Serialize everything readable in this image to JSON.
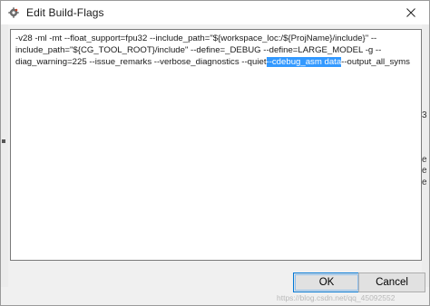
{
  "window": {
    "title": "Edit Build-Flags",
    "app_icon": "gear-icon",
    "close_icon": "close-icon"
  },
  "editor": {
    "line1": "-v28 -ml -mt --float_support=fpu32 --include_path=\"${workspace_loc:/${ProjName}/include}\" --",
    "line2": "include_path=\"${CG_TOOL_ROOT}/include\" --define=_DEBUG --define=LARGE_MODEL -g --",
    "line3_pre": "diag_warning=225 --issue_remarks --verbose_diagnostics --quiet",
    "line3_sel": "--cdebug_asm data",
    "line3_post": "--output_all_syms"
  },
  "buttons": {
    "ok": "OK",
    "cancel": "Cancel"
  },
  "watermark": "https://blog.csdn.net/qq_45092552",
  "right_strip": {
    "t1": "3",
    "t2": "e",
    "t3": "e",
    "t4": "e"
  }
}
